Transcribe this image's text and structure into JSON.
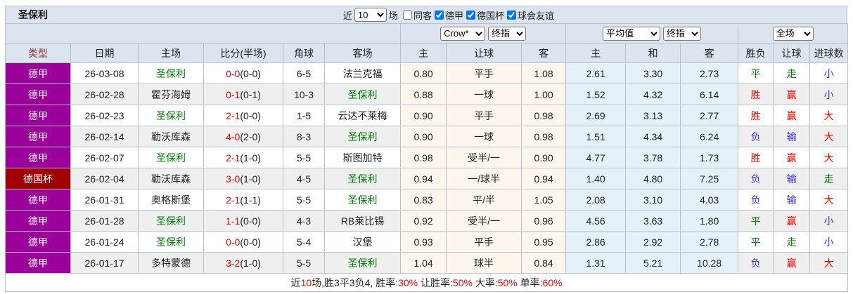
{
  "colors": {
    "header_bg": "#dce4f0",
    "border": "#b9c2cc",
    "type_header": "#8b3a3a",
    "bundesliga_badge": "#9b009b",
    "german_cup_badge": "#a00000",
    "red": "#ff0000",
    "green": "#008000",
    "blue": "#3333ff",
    "odds_bg": "#fcf6ec",
    "avg_bg": "#e4f1f8",
    "row_alt": "#efefef"
  },
  "titlebar": {
    "title": "圣保利",
    "recent_label": "近",
    "recent_count": "10",
    "matches_label": "场",
    "checkboxes": [
      {
        "key": "same-away",
        "label": "同客",
        "checked": false
      },
      {
        "key": "bundesliga",
        "label": "德甲",
        "checked": true
      },
      {
        "key": "german-cup",
        "label": "德国杯",
        "checked": true
      },
      {
        "key": "club-friendly",
        "label": "球会友谊",
        "checked": true
      }
    ]
  },
  "selects": {
    "odds_company": "Crow*",
    "odds_final": "终指",
    "average": "平均值",
    "average_final": "终指",
    "scope": "全场"
  },
  "columns": [
    "类型",
    "日期",
    "主场",
    "比分(半场)",
    "角球",
    "客场",
    "主",
    "让球",
    "客",
    "主",
    "和",
    "客",
    "胜负",
    "让球",
    "进球数"
  ],
  "rows": [
    {
      "league": "德甲",
      "date": "26-03-08",
      "home": "圣保利",
      "score_ft": "0-0",
      "score_ht": "(0-0)",
      "corners": "6-5",
      "away": "法兰克福",
      "odds": [
        "0.80",
        "平手",
        "1.08"
      ],
      "avg": [
        "2.61",
        "3.30",
        "2.73"
      ],
      "outcome": [
        [
          "平",
          "green"
        ],
        [
          "走",
          "green"
        ],
        [
          "小",
          "blue"
        ]
      ]
    },
    {
      "league": "德甲",
      "date": "26-02-28",
      "home": "霍芬海姆",
      "score_ft": "0-1",
      "score_ht": "(0-1)",
      "corners": "10-3",
      "away": "圣保利",
      "odds": [
        "0.88",
        "一球",
        "1.00"
      ],
      "avg": [
        "1.52",
        "4.32",
        "6.14"
      ],
      "outcome": [
        [
          "胜",
          "red"
        ],
        [
          "赢",
          "red"
        ],
        [
          "小",
          "blue"
        ]
      ]
    },
    {
      "league": "德甲",
      "date": "26-02-23",
      "home": "圣保利",
      "score_ft": "2-1",
      "score_ht": "(0-0)",
      "corners": "1-5",
      "away": "云达不莱梅",
      "odds": [
        "0.90",
        "平手",
        "0.98"
      ],
      "avg": [
        "2.69",
        "3.13",
        "2.77"
      ],
      "outcome": [
        [
          "胜",
          "red"
        ],
        [
          "赢",
          "red"
        ],
        [
          "大",
          "red"
        ]
      ]
    },
    {
      "league": "德甲",
      "date": "26-02-14",
      "home": "勒沃库森",
      "score_ft": "4-0",
      "score_ht": "(2-0)",
      "corners": "8-3",
      "away": "圣保利",
      "odds": [
        "0.90",
        "一球",
        "0.98"
      ],
      "avg": [
        "1.51",
        "4.34",
        "6.24"
      ],
      "outcome": [
        [
          "负",
          "blue"
        ],
        [
          "输",
          "blue"
        ],
        [
          "大",
          "red"
        ]
      ]
    },
    {
      "league": "德甲",
      "date": "26-02-07",
      "home": "圣保利",
      "score_ft": "2-1",
      "score_ht": "(1-0)",
      "corners": "5-5",
      "away": "斯图加特",
      "odds": [
        "0.98",
        "受半/一",
        "0.90"
      ],
      "avg": [
        "4.77",
        "3.78",
        "1.73"
      ],
      "outcome": [
        [
          "胜",
          "red"
        ],
        [
          "赢",
          "red"
        ],
        [
          "大",
          "red"
        ]
      ]
    },
    {
      "league": "德国杯",
      "date": "26-02-04",
      "home": "勒沃库森",
      "score_ft": "3-0",
      "score_ht": "(1-0)",
      "corners": "4-5",
      "away": "圣保利",
      "odds": [
        "0.94",
        "一/球半",
        "0.94"
      ],
      "avg": [
        "1.40",
        "4.80",
        "7.25"
      ],
      "outcome": [
        [
          "负",
          "blue"
        ],
        [
          "输",
          "blue"
        ],
        [
          "走",
          "green"
        ]
      ]
    },
    {
      "league": "德甲",
      "date": "26-01-31",
      "home": "奥格斯堡",
      "score_ft": "2-1",
      "score_ht": "(1-1)",
      "corners": "5-5",
      "away": "圣保利",
      "odds": [
        "0.83",
        "平/半",
        "1.05"
      ],
      "avg": [
        "2.08",
        "3.10",
        "4.03"
      ],
      "outcome": [
        [
          "负",
          "blue"
        ],
        [
          "输",
          "blue"
        ],
        [
          "大",
          "red"
        ]
      ]
    },
    {
      "league": "德甲",
      "date": "26-01-28",
      "home": "圣保利",
      "score_ft": "1-1",
      "score_ht": "(0-0)",
      "corners": "4-3",
      "away": "RB莱比锡",
      "odds": [
        "0.92",
        "受半/一",
        "0.96"
      ],
      "avg": [
        "4.56",
        "3.63",
        "1.80"
      ],
      "outcome": [
        [
          "平",
          "green"
        ],
        [
          "赢",
          "red"
        ],
        [
          "小",
          "blue"
        ]
      ]
    },
    {
      "league": "德甲",
      "date": "26-01-24",
      "home": "圣保利",
      "score_ft": "0-0",
      "score_ht": "(0-0)",
      "corners": "5-4",
      "away": "汉堡",
      "odds": [
        "0.93",
        "平手",
        "0.95"
      ],
      "avg": [
        "2.86",
        "2.92",
        "2.78"
      ],
      "outcome": [
        [
          "平",
          "green"
        ],
        [
          "走",
          "green"
        ],
        [
          "小",
          "blue"
        ]
      ]
    },
    {
      "league": "德甲",
      "date": "26-01-17",
      "home": "多特蒙德",
      "score_ft": "3-2",
      "score_ht": "(1-0)",
      "corners": "5-5",
      "away": "圣保利",
      "odds": [
        "1.04",
        "球半",
        "0.84"
      ],
      "avg": [
        "1.31",
        "5.21",
        "10.28"
      ],
      "outcome": [
        [
          "负",
          "blue"
        ],
        [
          "赢",
          "red"
        ],
        [
          "大",
          "red"
        ]
      ]
    }
  ],
  "footer": {
    "segments": [
      {
        "text": "近",
        "color": "black"
      },
      {
        "text": "10",
        "color": "red"
      },
      {
        "text": "场,胜3平3负4, 胜率:",
        "color": "black"
      },
      {
        "text": "30%",
        "color": "red"
      },
      {
        "text": " 让胜率:",
        "color": "black"
      },
      {
        "text": "50%",
        "color": "red"
      },
      {
        "text": " 大率:",
        "color": "black"
      },
      {
        "text": "50%",
        "color": "red"
      },
      {
        "text": " 单率:",
        "color": "black"
      },
      {
        "text": "60%",
        "color": "red"
      }
    ]
  }
}
